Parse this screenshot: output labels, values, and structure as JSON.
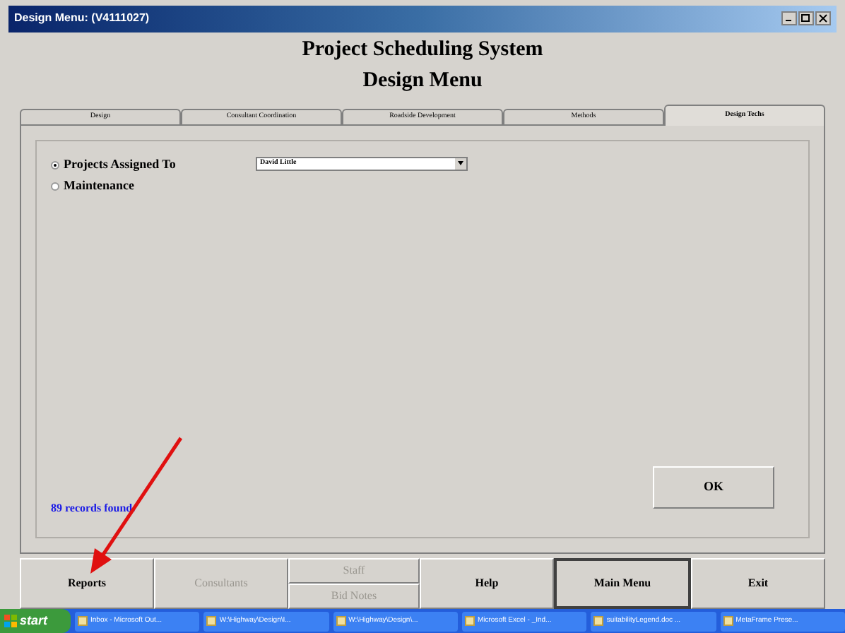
{
  "window": {
    "title": "Design Menu: (V4111027)"
  },
  "heading": "Project Scheduling System",
  "subheading": "Design Menu",
  "tabs": [
    {
      "label": "Design",
      "selected": false
    },
    {
      "label": "Consultant Coordination",
      "selected": false
    },
    {
      "label": "Roadside Development",
      "selected": false
    },
    {
      "label": "Methods",
      "selected": false
    },
    {
      "label": "Design Techs",
      "selected": true
    }
  ],
  "options": [
    {
      "label": "Projects Assigned To",
      "selected": true
    },
    {
      "label": "Maintenance",
      "selected": false
    }
  ],
  "assignee_select": {
    "value": "David Little"
  },
  "status": "89 records found.",
  "ok_button": "OK",
  "bottom_buttons": [
    {
      "kind": "button",
      "label": "Reports",
      "disabled": false
    },
    {
      "kind": "button",
      "label": "Consultants",
      "disabled": true
    },
    {
      "kind": "stack",
      "items": [
        {
          "label": "Staff",
          "disabled": true
        },
        {
          "label": "Bid Notes",
          "disabled": true
        }
      ]
    },
    {
      "kind": "button",
      "label": "Help",
      "disabled": false
    },
    {
      "kind": "button",
      "label": "Main Menu",
      "disabled": false,
      "default": true
    },
    {
      "kind": "button",
      "label": "Exit",
      "disabled": false
    }
  ],
  "taskbar": {
    "start": "start",
    "items": [
      {
        "label": "Inbox - Microsoft Out..."
      },
      {
        "label": "W:\\Highway\\Design\\I..."
      },
      {
        "label": "W:\\Highway\\Design\\..."
      },
      {
        "label": "Microsoft Excel - _Ind..."
      },
      {
        "label": "suitabilityLegend.doc ..."
      },
      {
        "label": "MetaFrame Prese..."
      }
    ]
  }
}
